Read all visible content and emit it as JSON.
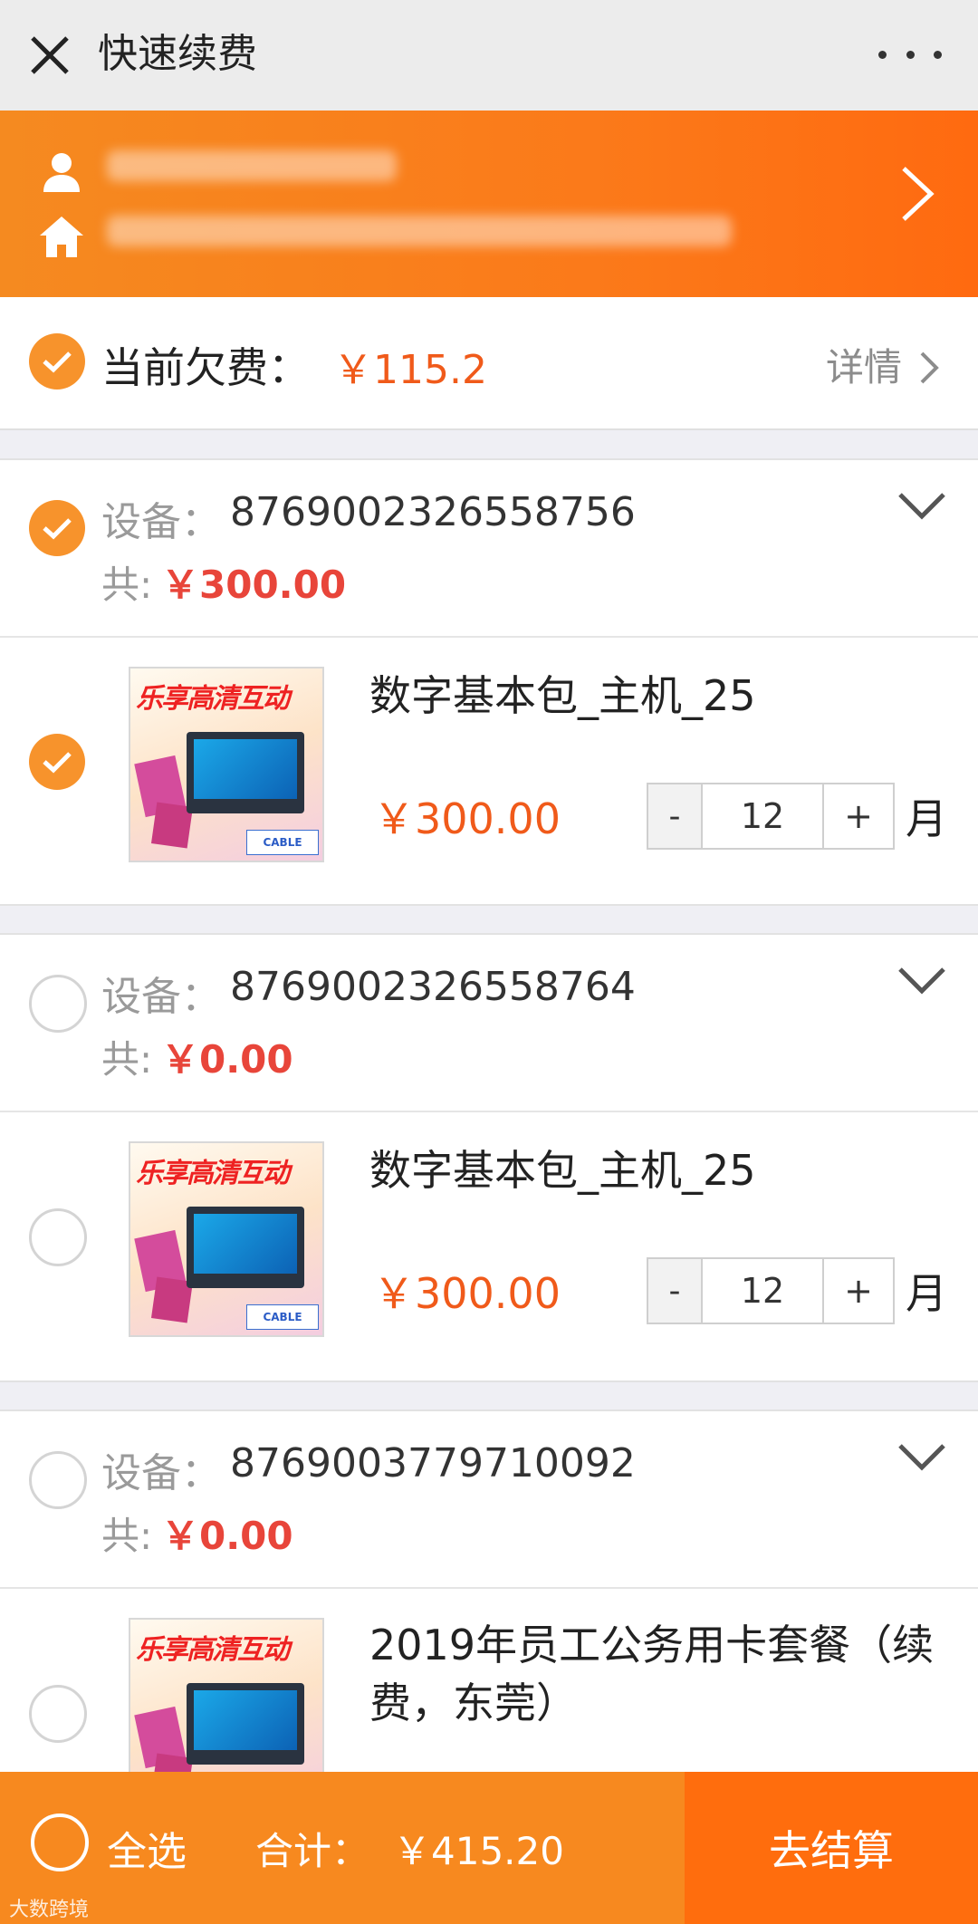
{
  "header": {
    "title": "快速续费",
    "close_icon": "close-icon",
    "more_icon": "more-icon"
  },
  "user": {
    "person_icon": "person-icon",
    "home_icon": "home-icon",
    "chevron": "chevron-right-icon"
  },
  "arrears": {
    "label": "当前欠费：",
    "amount": "￥115.2",
    "detail_label": "详情",
    "checked": true
  },
  "devices": [
    {
      "label": "设备：",
      "number": "8769002326558756",
      "total_label": "共:",
      "total": "￥300.00",
      "checked": true,
      "product": {
        "name": "数字基本包_主机_25",
        "price": "￥300.00",
        "qty": "12",
        "unit": "月",
        "minus": "-",
        "plus": "+",
        "checked": true,
        "thumb_text": "乐享高清互动"
      }
    },
    {
      "label": "设备：",
      "number": "8769002326558764",
      "total_label": "共:",
      "total": "￥0.00",
      "checked": false,
      "product": {
        "name": "数字基本包_主机_25",
        "price": "￥300.00",
        "qty": "12",
        "unit": "月",
        "minus": "-",
        "plus": "+",
        "checked": false,
        "thumb_text": "乐享高清互动"
      }
    },
    {
      "label": "设备：",
      "number": "8769003779710092",
      "total_label": "共:",
      "total": "￥0.00",
      "checked": false,
      "product": {
        "name": "2019年员工公务用卡套餐（续费，东莞）",
        "checked": false,
        "thumb_text": "乐享高清互动"
      }
    }
  ],
  "footer": {
    "select_all": "全选",
    "sum_label": "合计：",
    "sum_value": "￥415.20",
    "checkout": "去结算",
    "watermark": "大数跨境"
  },
  "colors": {
    "accent": "#f7891f",
    "checkout": "#ff6d0d",
    "price": "#f05a1a",
    "total": "#e8453a"
  }
}
